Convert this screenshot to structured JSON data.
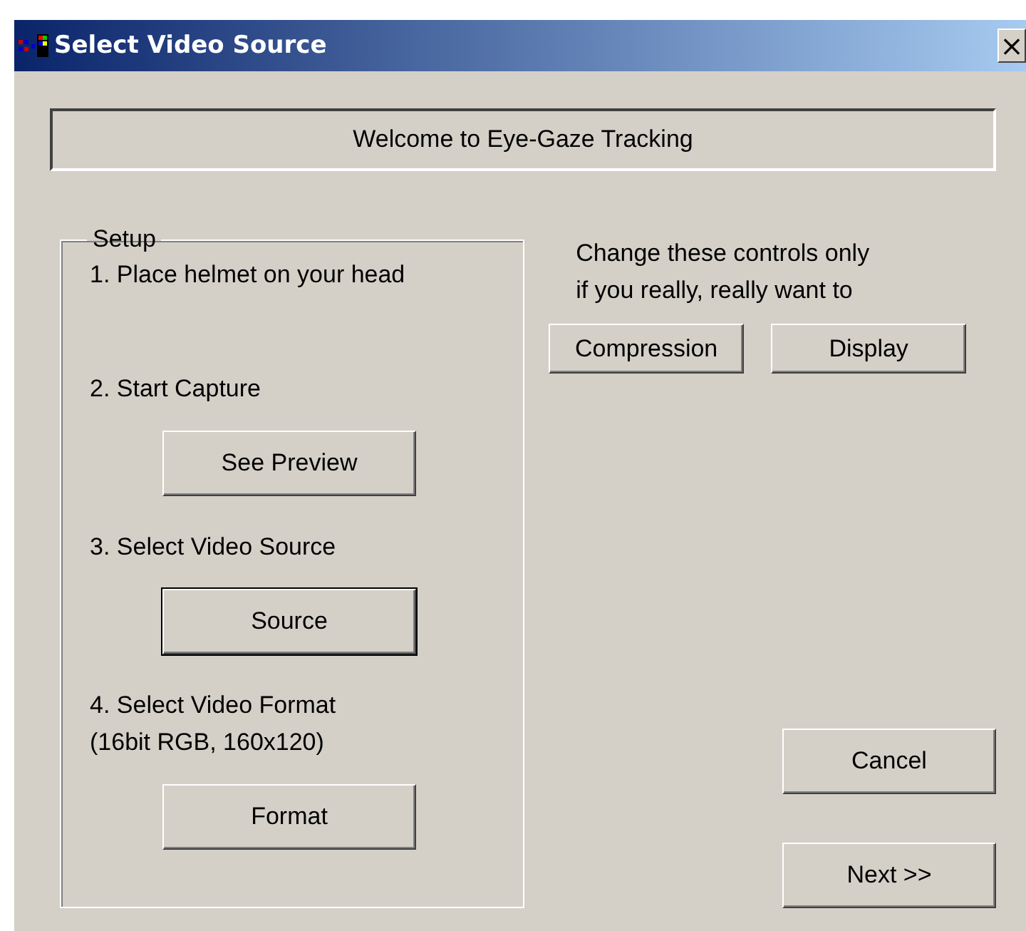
{
  "window": {
    "title": "Select Video Source",
    "close": "×"
  },
  "banner": "Welcome to Eye-Gaze Tracking",
  "setup": {
    "title": "Setup",
    "steps": [
      {
        "text": "1. Place helmet on your head"
      },
      {
        "text": "2. Start Capture",
        "button": {
          "label": "See Preview",
          "default": false
        }
      },
      {
        "text": "3. Select Video Source",
        "button": {
          "label": "Source",
          "default": true
        }
      },
      {
        "text": "4. Select Video Format\n(16bit RGB, 160x120)",
        "button": {
          "label": "Format",
          "default": false
        }
      }
    ]
  },
  "advanced": {
    "note": "Change these controls only\nif you really, really want to",
    "buttons": [
      {
        "label": "Compression",
        "default": false
      },
      {
        "label": "Display",
        "default": false
      }
    ]
  },
  "actions": [
    {
      "label": "Cancel",
      "default": false
    },
    {
      "label": "Next >>",
      "default": false
    }
  ]
}
